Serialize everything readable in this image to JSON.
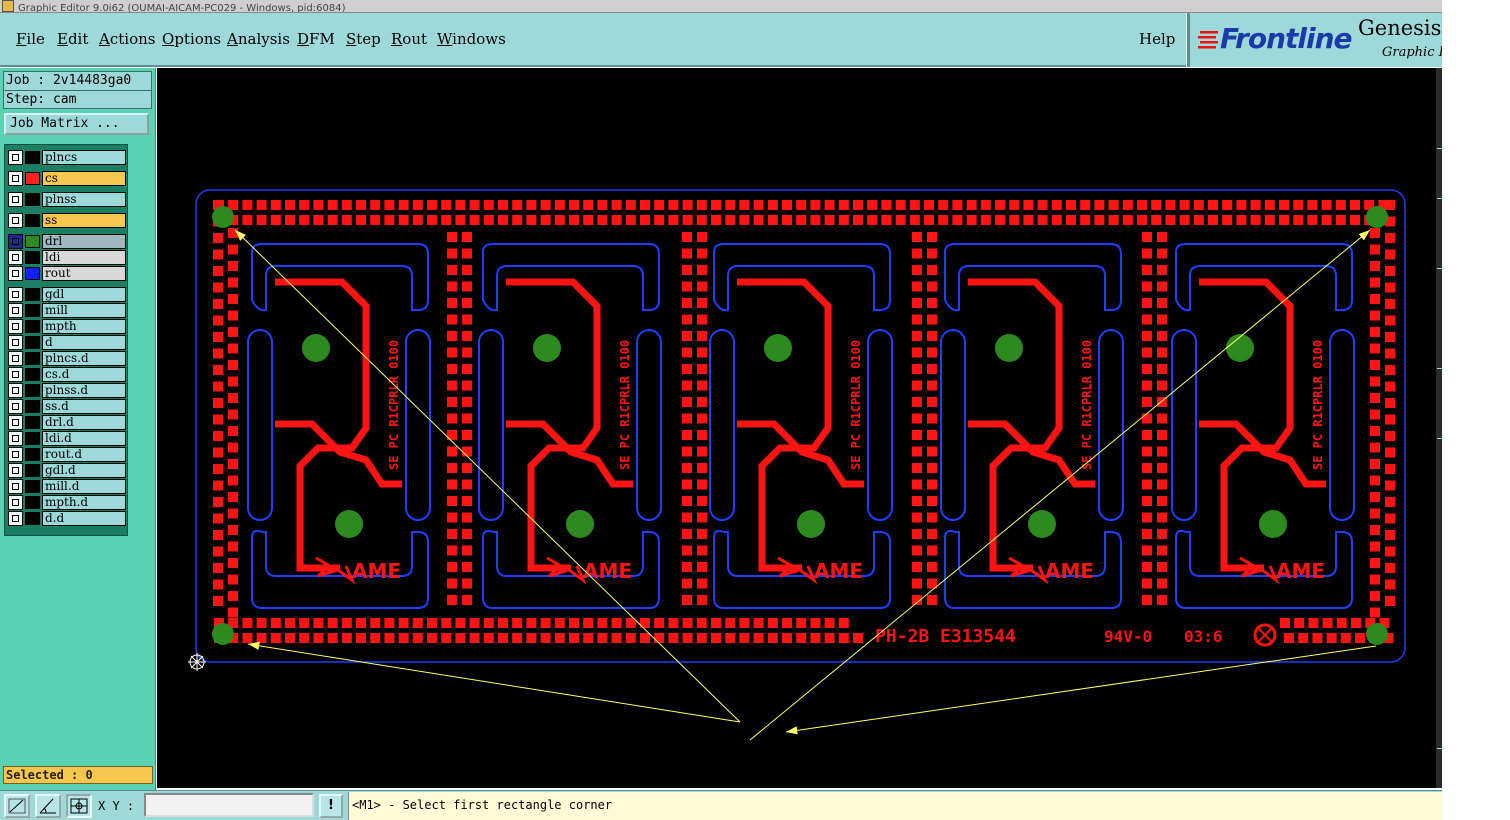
{
  "window": {
    "title": "Graphic Editor 9.0i62 (OUMAI-AICAM-PC029 - Windows, pid:6084)"
  },
  "menu": {
    "items": [
      {
        "mn": "F",
        "rest": "ile"
      },
      {
        "mn": "E",
        "rest": "dit"
      },
      {
        "mn": "A",
        "rest": "ctions"
      },
      {
        "mn": "O",
        "rest": "ptions"
      },
      {
        "mn": "A",
        "rest": "nalysis"
      },
      {
        "mn": "D",
        "rest": "FM"
      },
      {
        "mn": "S",
        "rest": "tep"
      },
      {
        "mn": "R",
        "rest": "out"
      },
      {
        "mn": "W",
        "rest": "indows"
      }
    ],
    "help": "Help"
  },
  "brand": {
    "logo": "Frontline",
    "product": "Genesis",
    "subtitle": "Graphic Editor",
    "logo_color": "#1a3aa8"
  },
  "job": {
    "job_line": "Job : 2v14483ga0",
    "step_line": "Step: cam",
    "matrix_button": "Job Matrix ..."
  },
  "layers": [
    {
      "name": "plncs",
      "color": "#000000",
      "highlight": "#9ed9d9"
    },
    {
      "name": "cs",
      "color": "#ff2020",
      "highlight": "#f7c64d"
    },
    {
      "name": "plnss",
      "color": "#000000",
      "highlight": "#9ed9d9"
    },
    {
      "name": "ss",
      "color": "#000000",
      "highlight": "#f7c64d"
    },
    {
      "name": "drl",
      "color": "#2e8b21",
      "highlight": "#9fb7bf",
      "active": true
    },
    {
      "name": "ldi",
      "color": "#000000",
      "highlight": "#d8d8d8"
    },
    {
      "name": "rout",
      "color": "#1020ff",
      "highlight": "#d8d8d8"
    },
    {
      "name": "gdl",
      "color": "#000000",
      "highlight": "#9ed9d9"
    },
    {
      "name": "mill",
      "color": "#000000",
      "highlight": "#9ed9d9"
    },
    {
      "name": "mpth",
      "color": "#000000",
      "highlight": "#9ed9d9"
    },
    {
      "name": "d",
      "color": "#000000",
      "highlight": "#9ed9d9"
    },
    {
      "name": "plncs.d",
      "color": "#000000",
      "highlight": "#9ed9d9"
    },
    {
      "name": "cs.d",
      "color": "#000000",
      "highlight": "#9ed9d9"
    },
    {
      "name": "plnss.d",
      "color": "#000000",
      "highlight": "#9ed9d9"
    },
    {
      "name": "ss.d",
      "color": "#000000",
      "highlight": "#9ed9d9"
    },
    {
      "name": "drl.d",
      "color": "#000000",
      "highlight": "#9ed9d9"
    },
    {
      "name": "ldi.d",
      "color": "#000000",
      "highlight": "#9ed9d9"
    },
    {
      "name": "rout.d",
      "color": "#000000",
      "highlight": "#9ed9d9"
    },
    {
      "name": "gdl.d",
      "color": "#000000",
      "highlight": "#9ed9d9"
    },
    {
      "name": "mill.d",
      "color": "#000000",
      "highlight": "#9ed9d9"
    },
    {
      "name": "mpth.d",
      "color": "#000000",
      "highlight": "#9ed9d9"
    },
    {
      "name": "d.d",
      "color": "#000000",
      "highlight": "#9ed9d9"
    }
  ],
  "status": {
    "selected": "Selected : 0"
  },
  "bottom": {
    "xy_label": "X Y :",
    "xy_value": "",
    "exclaim": "!",
    "message": "<M1> - Select first rectangle corner"
  },
  "board": {
    "marking": "PH-2B E313544",
    "grade": "94V-0",
    "date_code": "03:6",
    "unit_logo": "AME",
    "vertical_text": "SE PC R1CPRLR 0100",
    "units": 5,
    "colors": {
      "copper": "#ff1414",
      "outline": "#1f3fff",
      "drill": "#2d8a1e",
      "annotation": "#ffff66",
      "background": "#000000"
    }
  }
}
